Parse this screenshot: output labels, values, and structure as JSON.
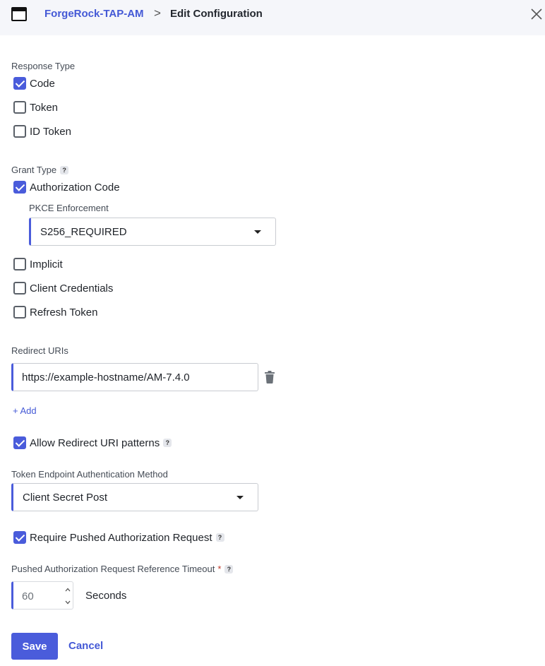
{
  "header": {
    "app_name": "ForgeRock-TAP-AM",
    "separator": ">",
    "current_page": "Edit Configuration"
  },
  "response_type": {
    "label": "Response Type",
    "options": [
      {
        "label": "Code",
        "checked": true
      },
      {
        "label": "Token",
        "checked": false
      },
      {
        "label": "ID Token",
        "checked": false
      }
    ]
  },
  "grant_type": {
    "label": "Grant Type",
    "help": "?",
    "authorization_code": {
      "label": "Authorization Code",
      "checked": true
    },
    "pkce": {
      "label": "PKCE Enforcement",
      "value": "S256_REQUIRED"
    },
    "options": [
      {
        "label": "Implicit",
        "checked": false
      },
      {
        "label": "Client Credentials",
        "checked": false
      },
      {
        "label": "Refresh Token",
        "checked": false
      }
    ]
  },
  "redirect_uris": {
    "label": "Redirect URIs",
    "values": [
      "https://example-hostname/AM-7.4.0"
    ],
    "add_label": "+ Add"
  },
  "allow_redirect_patterns": {
    "label": "Allow Redirect URI patterns",
    "checked": true,
    "help": "?"
  },
  "token_endpoint_auth": {
    "label": "Token Endpoint Authentication Method",
    "value": "Client Secret Post"
  },
  "require_par": {
    "label": "Require Pushed Authorization Request",
    "checked": true,
    "help": "?"
  },
  "par_timeout": {
    "label": "Pushed Authorization Request Reference Timeout",
    "required_marker": "*",
    "help": "?",
    "value": "60",
    "unit": "Seconds"
  },
  "actions": {
    "save_label": "Save",
    "cancel_label": "Cancel"
  },
  "colors": {
    "accent": "#4a5cdb",
    "link": "#4459d6",
    "header_bg": "#f5f6fa"
  }
}
